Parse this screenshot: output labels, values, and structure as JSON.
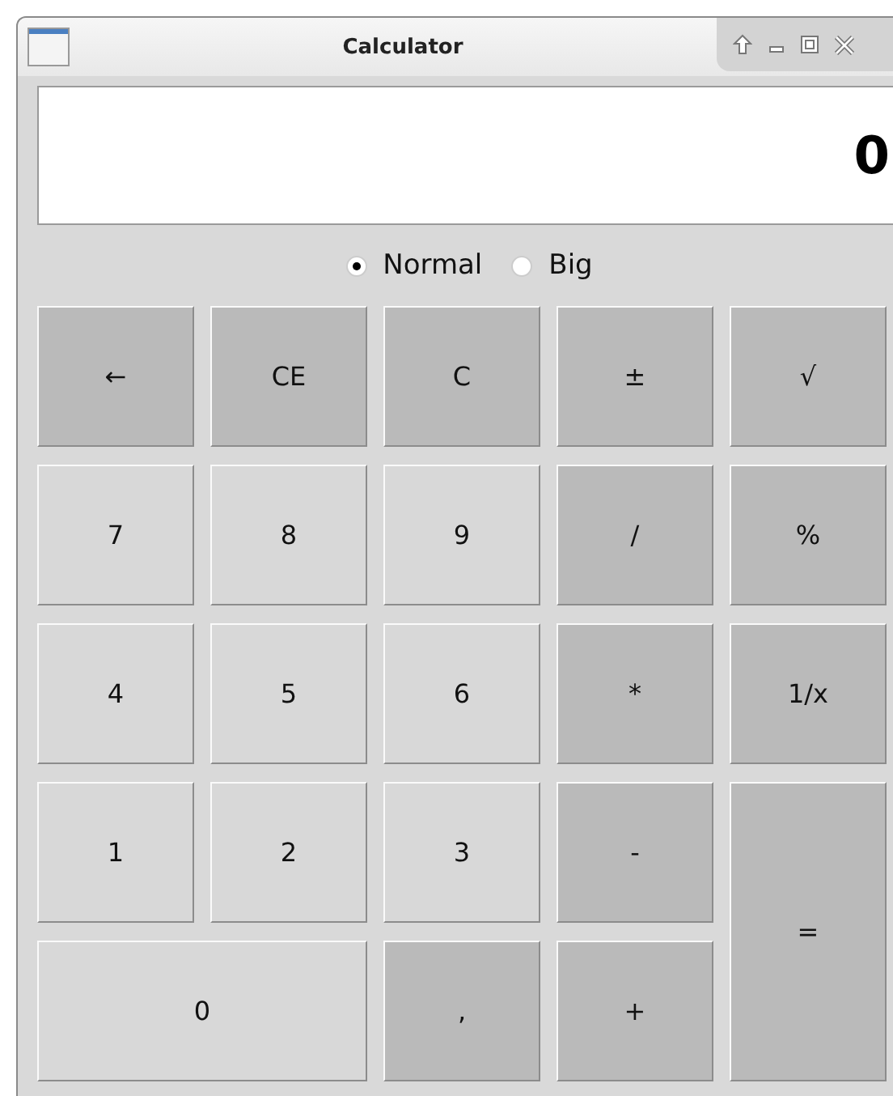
{
  "window": {
    "title": "Calculator"
  },
  "display": {
    "value": "0"
  },
  "sizes": [
    {
      "label": "Normal",
      "selected": true
    },
    {
      "label": "Big",
      "selected": false
    }
  ],
  "buttons": [
    {
      "label": "←",
      "kind": "op"
    },
    {
      "label": "CE",
      "kind": "op"
    },
    {
      "label": "C",
      "kind": "op"
    },
    {
      "label": "±",
      "kind": "op"
    },
    {
      "label": "√",
      "kind": "op"
    },
    {
      "label": "7",
      "kind": "digit"
    },
    {
      "label": "8",
      "kind": "digit"
    },
    {
      "label": "9",
      "kind": "digit"
    },
    {
      "label": "/",
      "kind": "op"
    },
    {
      "label": "%",
      "kind": "op"
    },
    {
      "label": "4",
      "kind": "digit"
    },
    {
      "label": "5",
      "kind": "digit"
    },
    {
      "label": "6",
      "kind": "digit"
    },
    {
      "label": "*",
      "kind": "op"
    },
    {
      "label": "1/x",
      "kind": "op"
    },
    {
      "label": "1",
      "kind": "digit"
    },
    {
      "label": "2",
      "kind": "digit"
    },
    {
      "label": "3",
      "kind": "digit"
    },
    {
      "label": "-",
      "kind": "op"
    },
    {
      "label": "=",
      "kind": "equals"
    },
    {
      "label": "0",
      "kind": "zero"
    },
    {
      "label": ",",
      "kind": "op"
    },
    {
      "label": "+",
      "kind": "op"
    }
  ]
}
